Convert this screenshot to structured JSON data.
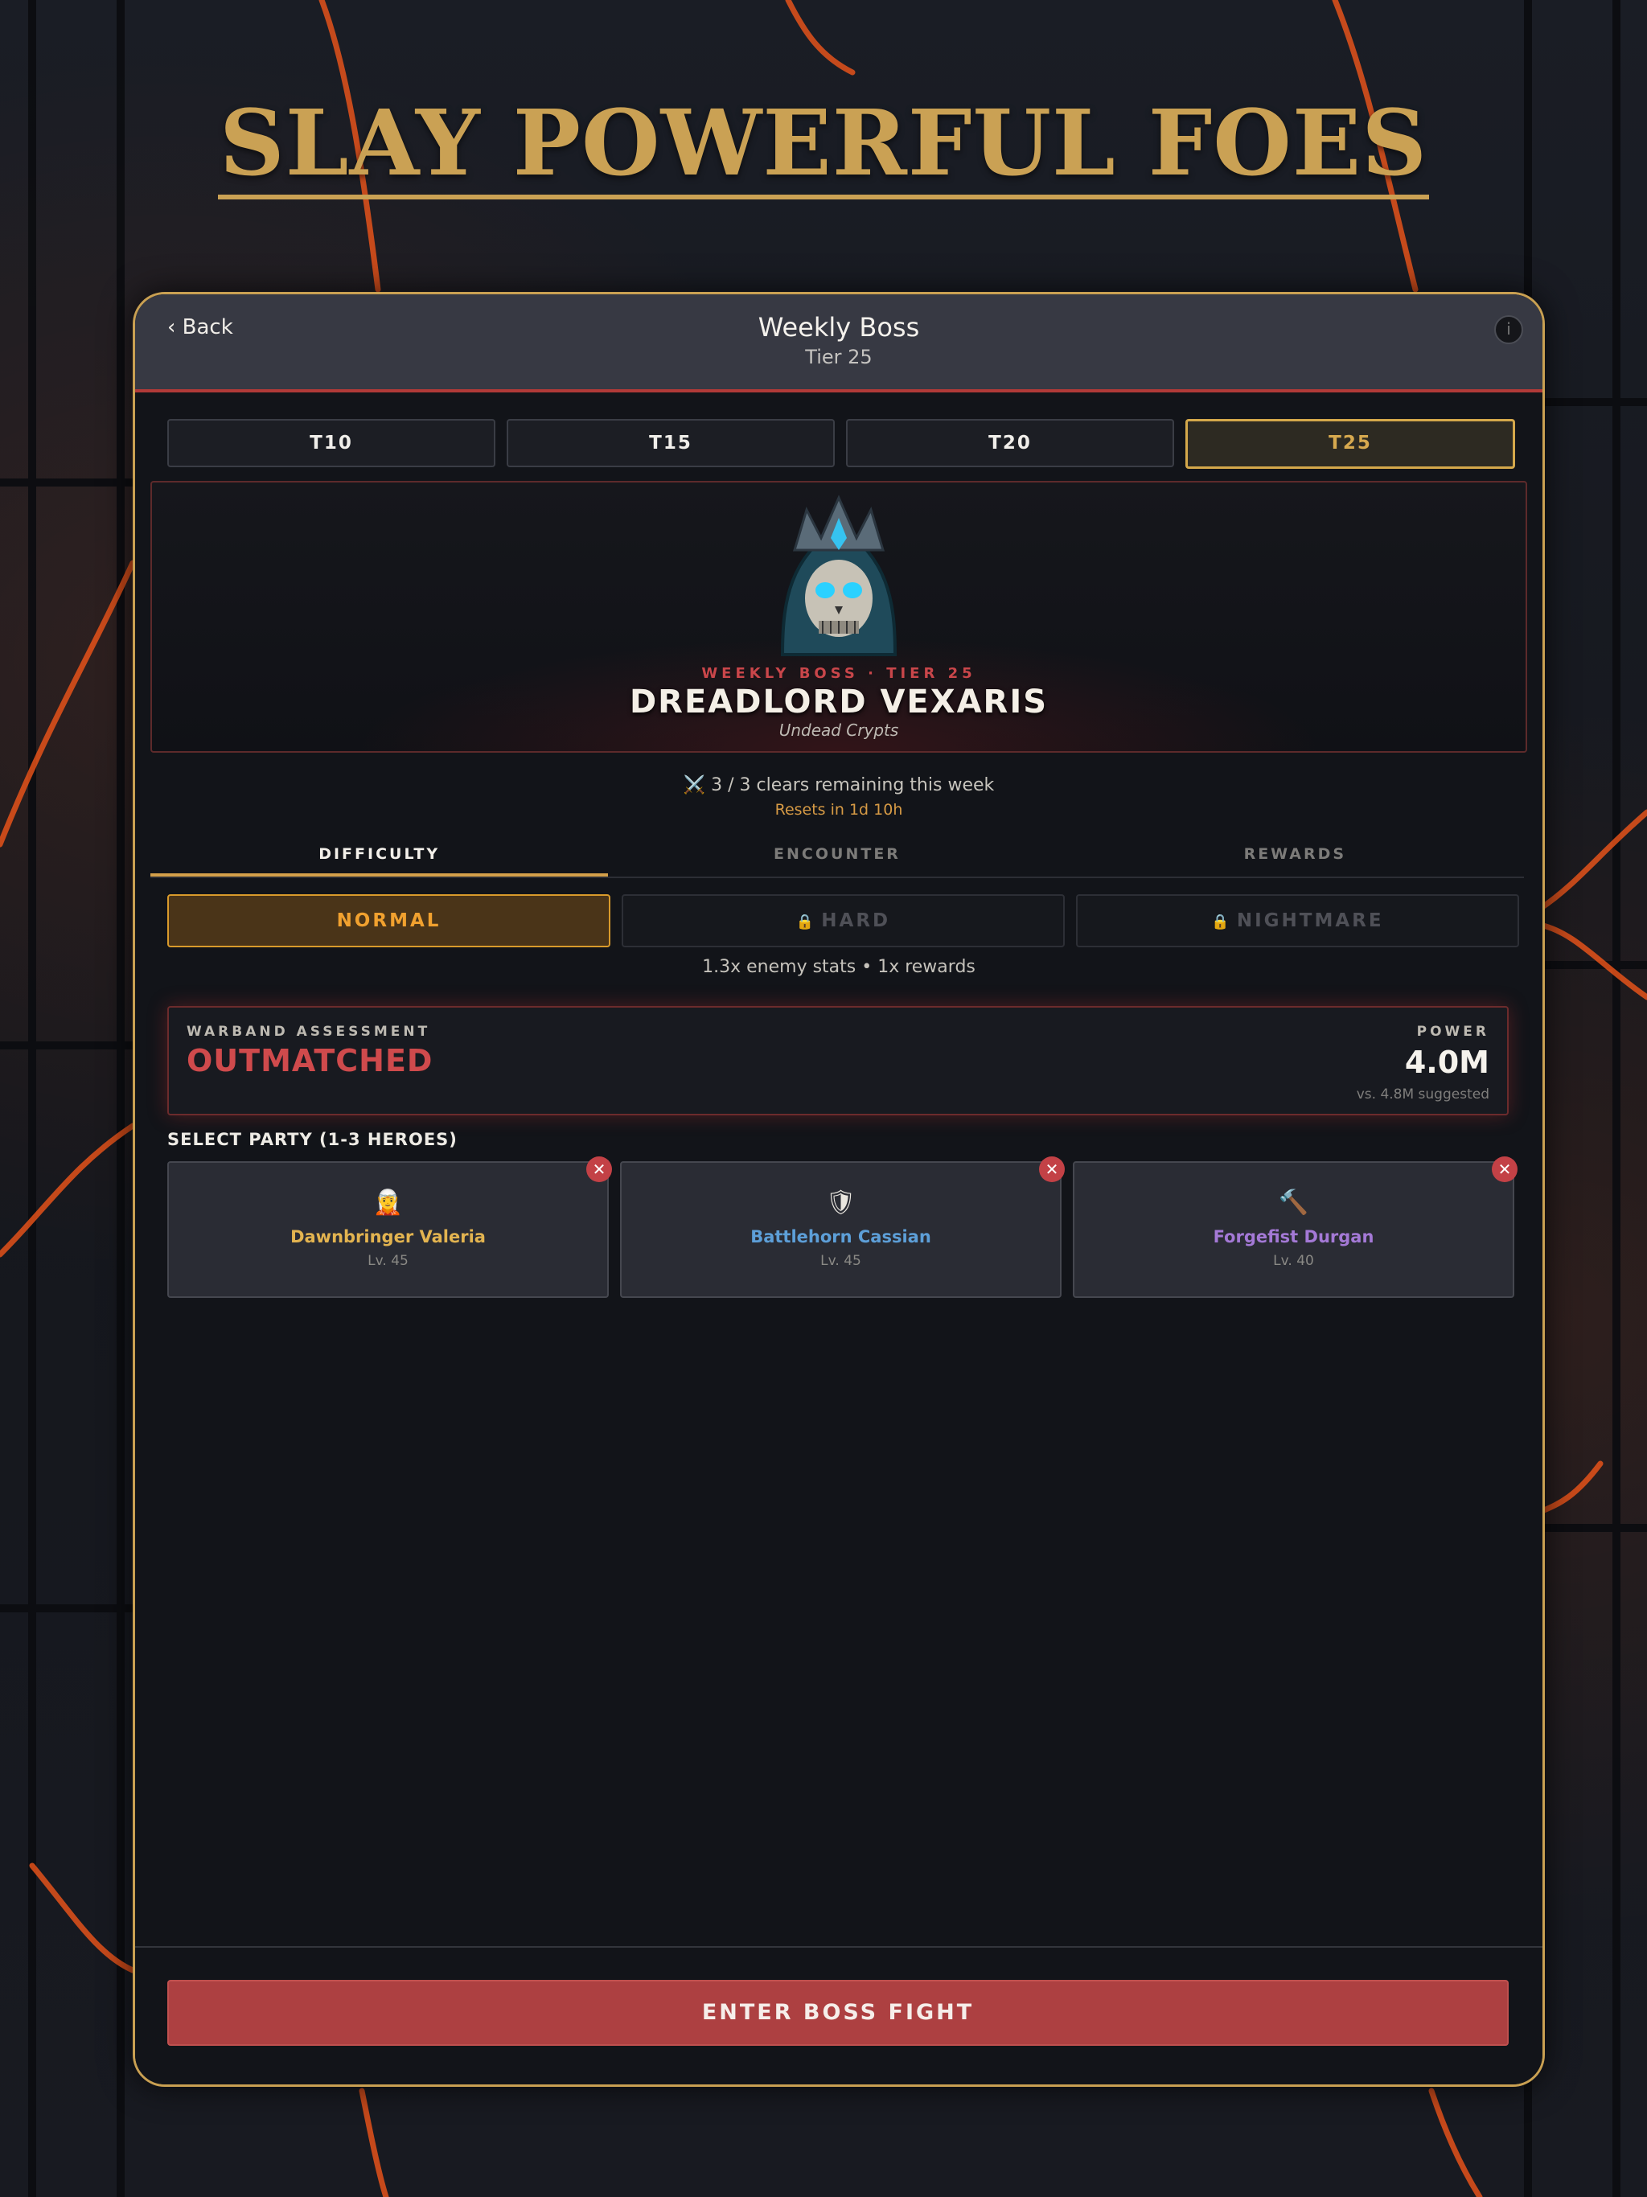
{
  "headline": "SLAY POWERFUL FOES",
  "header": {
    "back_label": "‹ Back",
    "title": "Weekly Boss",
    "subtitle": "Tier 25",
    "info_icon": "info-icon"
  },
  "tiers": [
    "T10",
    "T15",
    "T20",
    "T25"
  ],
  "selected_tier": "T25",
  "boss": {
    "kicker": "WEEKLY BOSS · TIER 25",
    "name": "DREADLORD VEXARIS",
    "location": "Undead Crypts"
  },
  "clears": {
    "text": "⚔️ 3 / 3 clears remaining this week",
    "reset": "Resets in 1d 10h"
  },
  "tabs": [
    "DIFFICULTY",
    "ENCOUNTER",
    "REWARDS"
  ],
  "selected_tab": "DIFFICULTY",
  "difficulties": [
    {
      "label": "NORMAL",
      "locked": false
    },
    {
      "label": "HARD",
      "locked": true
    },
    {
      "label": "NIGHTMARE",
      "locked": true
    }
  ],
  "difficulty_note": "1.3x enemy stats • 1x rewards",
  "assessment": {
    "label": "WARBAND ASSESSMENT",
    "status": "OUTMATCHED",
    "power_label": "POWER",
    "power": "4.0M",
    "suggested": "vs. 4.8M suggested"
  },
  "party": {
    "label": "SELECT PARTY (1-3 HEROES)",
    "heroes": [
      {
        "name": "Dawnbringer Valeria",
        "level": "Lv. 45",
        "color": "#e3b450"
      },
      {
        "name": "Battlehorn Cassian",
        "level": "Lv. 45",
        "color": "#5d9fd8"
      },
      {
        "name": "Forgefist Durgan",
        "level": "Lv. 40",
        "color": "#a479d6"
      }
    ]
  },
  "enter_label": "ENTER BOSS FIGHT",
  "colors": {
    "gold": "#c9a052",
    "danger": "#cf4a4c",
    "accent": "#d99a2b"
  }
}
